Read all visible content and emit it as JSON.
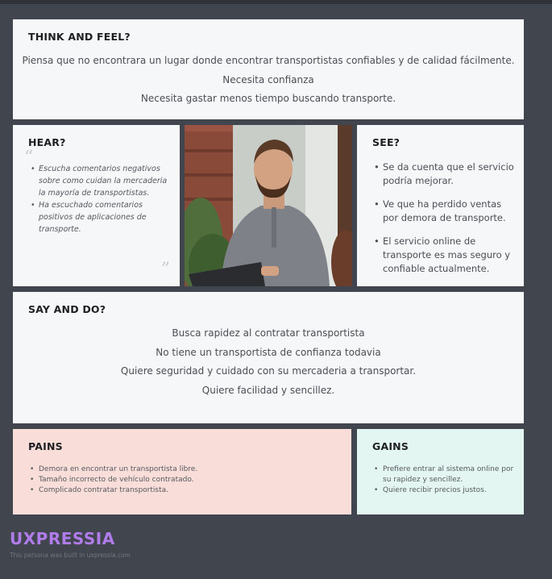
{
  "think": {
    "title": "THINK AND FEEL?",
    "lines": [
      "Piensa que no encontrara un lugar donde encontrar transportistas confiables y de calidad fácilmente.",
      "Necesita confianza",
      "Necesita gastar menos tiempo buscando transporte."
    ]
  },
  "hear": {
    "title": "HEAR?",
    "quote_open": "“",
    "quote_close": "”",
    "items": [
      "Escucha comentarios negativos sobre como cuidan la mercaderia la mayoría de transportistas.",
      "Ha escuchado comentarios positivos de aplicaciones de transporte."
    ]
  },
  "see": {
    "title": "SEE?",
    "items": [
      "Se da cuenta que el servicio podría mejorar.",
      "Ve que ha perdido ventas por demora de transporte.",
      "El servicio online de transporte es mas seguro y confiable actualmente."
    ]
  },
  "say": {
    "title": "SAY AND DO?",
    "lines": [
      "Busca rapidez al contratar transportista",
      "No tiene un transportista de confianza todavia",
      "Quiere seguridad y cuidado con su mercaderia a transportar.",
      "Quiere facilidad y sencillez."
    ]
  },
  "pains": {
    "title": "PAINS",
    "items": [
      "Demora en encontrar un transportista libre.",
      "Tamaño incorrecto de vehículo contratado.",
      "Complicado contratar transportista."
    ]
  },
  "gains": {
    "title": "GAINS",
    "items": [
      "Prefiere entrar al sistema online por su rapidez y sencillez.",
      "Quiere recibir precios justos."
    ]
  },
  "brand": "UXPRESSIA",
  "footer": "This persona was built in uxpressia.com",
  "colors": {
    "background": "#41454d",
    "card": "#f6f7f9",
    "pains": "#f9ddd8",
    "gains": "#e4f6f1",
    "brand": "#b07bea"
  }
}
